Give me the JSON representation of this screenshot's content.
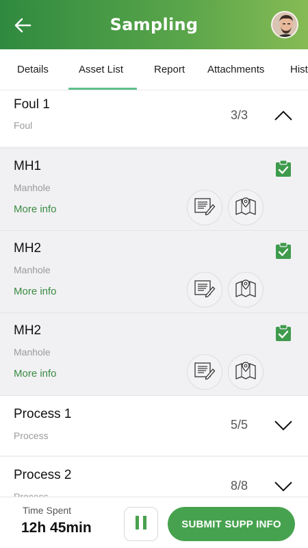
{
  "header": {
    "title": "Sampling"
  },
  "tabs": [
    {
      "label": "Details"
    },
    {
      "label": "Asset List"
    },
    {
      "label": "Report"
    },
    {
      "label": "Attachments"
    },
    {
      "label": "Hist"
    }
  ],
  "active_tab": "Asset List",
  "groups": [
    {
      "title": "Foul 1",
      "subtitle": "Foul",
      "count": "3/3",
      "expanded": true
    },
    {
      "title": "Process 1",
      "subtitle": "Process",
      "count": "5/5",
      "expanded": false
    },
    {
      "title": "Process 2",
      "subtitle": "Process",
      "count": "8/8",
      "expanded": false
    }
  ],
  "assets": [
    {
      "title": "MH1",
      "subtitle": "Manhole",
      "more_info": "More info",
      "completed": true
    },
    {
      "title": "MH2",
      "subtitle": "Manhole",
      "more_info": "More info",
      "completed": true
    },
    {
      "title": "MH2",
      "subtitle": "Manhole",
      "more_info": "More info",
      "completed": true
    }
  ],
  "footer": {
    "time_label": "Time Spent",
    "time_value": "12h 45min",
    "submit_label": "SUBMIT SUPP INFO"
  },
  "colors": {
    "primary_green": "#47a24f",
    "header_gradient_start": "#2f8a3f",
    "header_gradient_end": "#86bb55",
    "tab_underline": "#5cc08a",
    "link_green": "#3a8a3f"
  },
  "icons": [
    "back-arrow-icon",
    "avatar",
    "chevron-up-icon",
    "chevron-down-icon",
    "clipboard-check-icon",
    "form-edit-icon",
    "map-pin-icon",
    "pause-icon"
  ]
}
